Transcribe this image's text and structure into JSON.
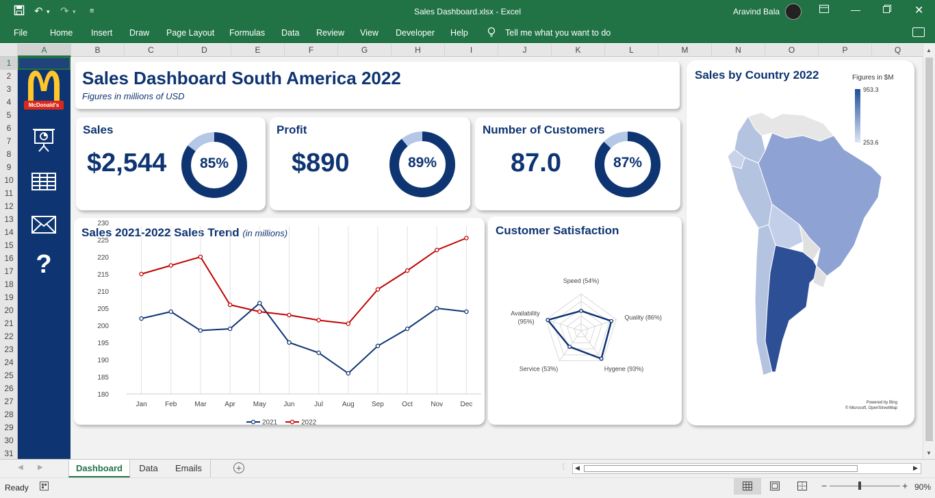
{
  "window": {
    "title": "Sales Dashboard.xlsx  -  Excel",
    "user": "Aravind Bala"
  },
  "menu": [
    "File",
    "Home",
    "Insert",
    "Draw",
    "Page Layout",
    "Formulas",
    "Data",
    "Review",
    "View",
    "Developer",
    "Help"
  ],
  "tell_me": "Tell me what you want to do",
  "columns": [
    "A",
    "B",
    "C",
    "D",
    "E",
    "F",
    "G",
    "H",
    "I",
    "J",
    "K",
    "L",
    "M",
    "N",
    "O",
    "P",
    "Q"
  ],
  "rows": [
    "1",
    "2",
    "3",
    "4",
    "5",
    "6",
    "7",
    "8",
    "9",
    "10",
    "11",
    "12",
    "13",
    "14",
    "15",
    "16",
    "17",
    "18",
    "19",
    "20",
    "21",
    "22",
    "23",
    "24",
    "25",
    "26",
    "27",
    "28",
    "29",
    "30",
    "31"
  ],
  "sidebar": {
    "logo_text": "McDonald's",
    "logo_color": "#ffc72c",
    "logo_bg": "#da291c",
    "icons": [
      "presentation-icon",
      "table-icon",
      "mail-icon",
      "help-icon"
    ],
    "help_glyph": "?"
  },
  "header": {
    "title": "Sales Dashboard South America 2022",
    "subtitle": "Figures in millions of USD"
  },
  "kpis": [
    {
      "label": "Sales",
      "value": "$2,544",
      "pct": 85,
      "pct_label": "85%"
    },
    {
      "label": "Profit",
      "value": "$890",
      "pct": 89,
      "pct_label": "89%"
    },
    {
      "label": "Number of Customers",
      "value": "87.0",
      "pct": 87,
      "pct_label": "87%"
    }
  ],
  "colors": {
    "navy": "#0e3471",
    "red": "#c00000",
    "light": "#b4c7e7",
    "ribbon": "#217346"
  },
  "trend": {
    "title": "Sales 2021-2022 Sales Trend",
    "title_note": "(in millions)"
  },
  "chart_data": [
    {
      "type": "line",
      "x": [
        "Jan",
        "Feb",
        "Mar",
        "Apr",
        "May",
        "Jun",
        "Jul",
        "Aug",
        "Sep",
        "Oct",
        "Nov",
        "Dec"
      ],
      "series": [
        {
          "name": "2021",
          "values": [
            202,
            204,
            198.5,
            199,
            206.5,
            195,
            192,
            186,
            194,
            199,
            205,
            204
          ],
          "color": "#0e3471"
        },
        {
          "name": "2022",
          "values": [
            215,
            217.5,
            220,
            206,
            204,
            203,
            201.5,
            200.5,
            210.5,
            216,
            222,
            225.5
          ],
          "color": "#c00000"
        }
      ],
      "ylim": [
        180,
        230
      ],
      "yticks": [
        180,
        185,
        190,
        195,
        200,
        205,
        210,
        215,
        220,
        225,
        230
      ],
      "grid": "vertical",
      "legend": "bottom"
    },
    {
      "type": "radar",
      "title": "Customer Satisfaction",
      "axes": [
        "Speed (54%)",
        "Quality (86%)",
        "Hygene (93%)",
        "Service (53%)",
        "Availability (95%)"
      ],
      "values": [
        54,
        86,
        93,
        53,
        95
      ],
      "max": 100
    },
    {
      "type": "map",
      "title": "Sales by Country 2022",
      "legend_title": "Figures in $M",
      "legend_max": "953.3",
      "legend_min": "253.6",
      "attribution_1": "Powered by Bing",
      "attribution_2": "© Microsoft, OpenStreetMap"
    }
  ],
  "sheets": [
    "Dashboard",
    "Data",
    "Emails"
  ],
  "status": {
    "ready": "Ready",
    "zoom": "90%"
  }
}
